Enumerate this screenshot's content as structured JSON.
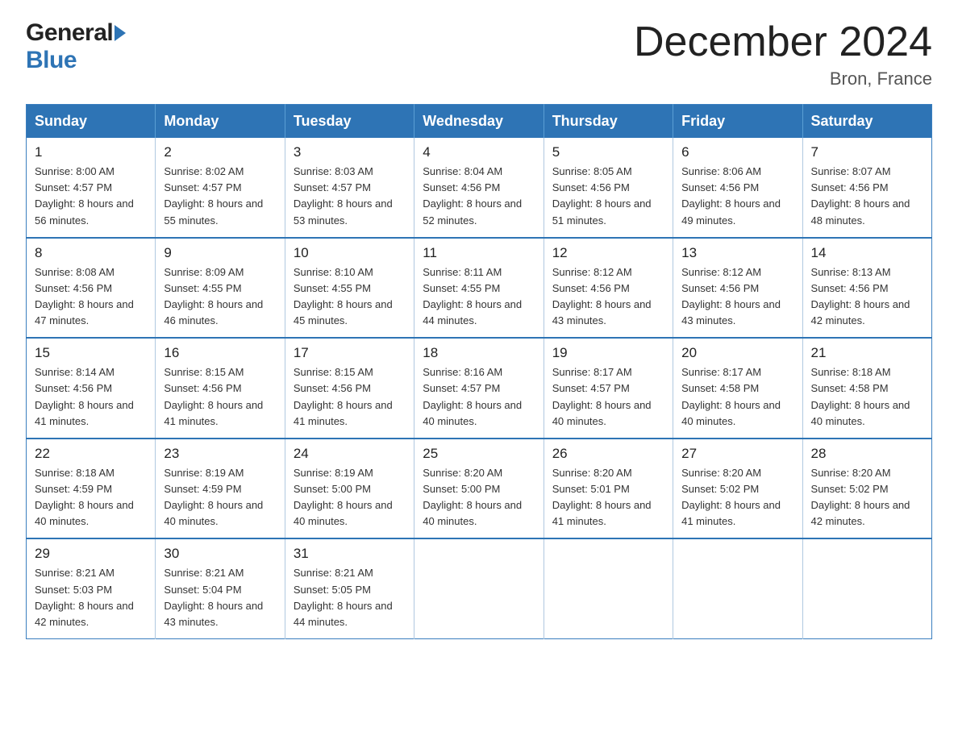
{
  "header": {
    "logo_general": "General",
    "logo_blue": "Blue",
    "month_title": "December 2024",
    "location": "Bron, France"
  },
  "days_of_week": [
    "Sunday",
    "Monday",
    "Tuesday",
    "Wednesday",
    "Thursday",
    "Friday",
    "Saturday"
  ],
  "weeks": [
    [
      {
        "day": "1",
        "sunrise": "Sunrise: 8:00 AM",
        "sunset": "Sunset: 4:57 PM",
        "daylight": "Daylight: 8 hours and 56 minutes."
      },
      {
        "day": "2",
        "sunrise": "Sunrise: 8:02 AM",
        "sunset": "Sunset: 4:57 PM",
        "daylight": "Daylight: 8 hours and 55 minutes."
      },
      {
        "day": "3",
        "sunrise": "Sunrise: 8:03 AM",
        "sunset": "Sunset: 4:57 PM",
        "daylight": "Daylight: 8 hours and 53 minutes."
      },
      {
        "day": "4",
        "sunrise": "Sunrise: 8:04 AM",
        "sunset": "Sunset: 4:56 PM",
        "daylight": "Daylight: 8 hours and 52 minutes."
      },
      {
        "day": "5",
        "sunrise": "Sunrise: 8:05 AM",
        "sunset": "Sunset: 4:56 PM",
        "daylight": "Daylight: 8 hours and 51 minutes."
      },
      {
        "day": "6",
        "sunrise": "Sunrise: 8:06 AM",
        "sunset": "Sunset: 4:56 PM",
        "daylight": "Daylight: 8 hours and 49 minutes."
      },
      {
        "day": "7",
        "sunrise": "Sunrise: 8:07 AM",
        "sunset": "Sunset: 4:56 PM",
        "daylight": "Daylight: 8 hours and 48 minutes."
      }
    ],
    [
      {
        "day": "8",
        "sunrise": "Sunrise: 8:08 AM",
        "sunset": "Sunset: 4:56 PM",
        "daylight": "Daylight: 8 hours and 47 minutes."
      },
      {
        "day": "9",
        "sunrise": "Sunrise: 8:09 AM",
        "sunset": "Sunset: 4:55 PM",
        "daylight": "Daylight: 8 hours and 46 minutes."
      },
      {
        "day": "10",
        "sunrise": "Sunrise: 8:10 AM",
        "sunset": "Sunset: 4:55 PM",
        "daylight": "Daylight: 8 hours and 45 minutes."
      },
      {
        "day": "11",
        "sunrise": "Sunrise: 8:11 AM",
        "sunset": "Sunset: 4:55 PM",
        "daylight": "Daylight: 8 hours and 44 minutes."
      },
      {
        "day": "12",
        "sunrise": "Sunrise: 8:12 AM",
        "sunset": "Sunset: 4:56 PM",
        "daylight": "Daylight: 8 hours and 43 minutes."
      },
      {
        "day": "13",
        "sunrise": "Sunrise: 8:12 AM",
        "sunset": "Sunset: 4:56 PM",
        "daylight": "Daylight: 8 hours and 43 minutes."
      },
      {
        "day": "14",
        "sunrise": "Sunrise: 8:13 AM",
        "sunset": "Sunset: 4:56 PM",
        "daylight": "Daylight: 8 hours and 42 minutes."
      }
    ],
    [
      {
        "day": "15",
        "sunrise": "Sunrise: 8:14 AM",
        "sunset": "Sunset: 4:56 PM",
        "daylight": "Daylight: 8 hours and 41 minutes."
      },
      {
        "day": "16",
        "sunrise": "Sunrise: 8:15 AM",
        "sunset": "Sunset: 4:56 PM",
        "daylight": "Daylight: 8 hours and 41 minutes."
      },
      {
        "day": "17",
        "sunrise": "Sunrise: 8:15 AM",
        "sunset": "Sunset: 4:56 PM",
        "daylight": "Daylight: 8 hours and 41 minutes."
      },
      {
        "day": "18",
        "sunrise": "Sunrise: 8:16 AM",
        "sunset": "Sunset: 4:57 PM",
        "daylight": "Daylight: 8 hours and 40 minutes."
      },
      {
        "day": "19",
        "sunrise": "Sunrise: 8:17 AM",
        "sunset": "Sunset: 4:57 PM",
        "daylight": "Daylight: 8 hours and 40 minutes."
      },
      {
        "day": "20",
        "sunrise": "Sunrise: 8:17 AM",
        "sunset": "Sunset: 4:58 PM",
        "daylight": "Daylight: 8 hours and 40 minutes."
      },
      {
        "day": "21",
        "sunrise": "Sunrise: 8:18 AM",
        "sunset": "Sunset: 4:58 PM",
        "daylight": "Daylight: 8 hours and 40 minutes."
      }
    ],
    [
      {
        "day": "22",
        "sunrise": "Sunrise: 8:18 AM",
        "sunset": "Sunset: 4:59 PM",
        "daylight": "Daylight: 8 hours and 40 minutes."
      },
      {
        "day": "23",
        "sunrise": "Sunrise: 8:19 AM",
        "sunset": "Sunset: 4:59 PM",
        "daylight": "Daylight: 8 hours and 40 minutes."
      },
      {
        "day": "24",
        "sunrise": "Sunrise: 8:19 AM",
        "sunset": "Sunset: 5:00 PM",
        "daylight": "Daylight: 8 hours and 40 minutes."
      },
      {
        "day": "25",
        "sunrise": "Sunrise: 8:20 AM",
        "sunset": "Sunset: 5:00 PM",
        "daylight": "Daylight: 8 hours and 40 minutes."
      },
      {
        "day": "26",
        "sunrise": "Sunrise: 8:20 AM",
        "sunset": "Sunset: 5:01 PM",
        "daylight": "Daylight: 8 hours and 41 minutes."
      },
      {
        "day": "27",
        "sunrise": "Sunrise: 8:20 AM",
        "sunset": "Sunset: 5:02 PM",
        "daylight": "Daylight: 8 hours and 41 minutes."
      },
      {
        "day": "28",
        "sunrise": "Sunrise: 8:20 AM",
        "sunset": "Sunset: 5:02 PM",
        "daylight": "Daylight: 8 hours and 42 minutes."
      }
    ],
    [
      {
        "day": "29",
        "sunrise": "Sunrise: 8:21 AM",
        "sunset": "Sunset: 5:03 PM",
        "daylight": "Daylight: 8 hours and 42 minutes."
      },
      {
        "day": "30",
        "sunrise": "Sunrise: 8:21 AM",
        "sunset": "Sunset: 5:04 PM",
        "daylight": "Daylight: 8 hours and 43 minutes."
      },
      {
        "day": "31",
        "sunrise": "Sunrise: 8:21 AM",
        "sunset": "Sunset: 5:05 PM",
        "daylight": "Daylight: 8 hours and 44 minutes."
      },
      null,
      null,
      null,
      null
    ]
  ]
}
